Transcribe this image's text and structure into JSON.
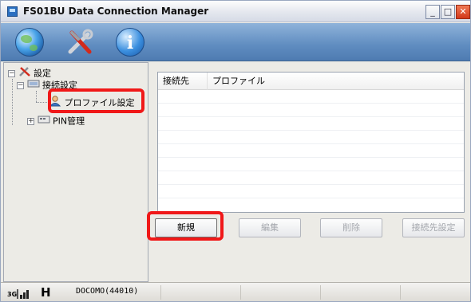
{
  "window": {
    "title": "FS01BU Data Connection Manager"
  },
  "toolbar": {
    "icons": [
      "globe-icon",
      "tools-icon",
      "info-icon"
    ],
    "info_glyph": "i"
  },
  "tree": {
    "root_label": "設定",
    "child_connection": "接続設定",
    "profile_settings": "プロファイル設定",
    "pin_management": "PIN管理",
    "expander_minus": "−",
    "expander_plus": "+"
  },
  "list": {
    "columns": [
      "接続先",
      "プロファイル"
    ]
  },
  "buttons": {
    "new_label": "新規",
    "edit_label": "編集",
    "delete_label": "削除",
    "connect_settings_label": "接続先設定"
  },
  "status": {
    "network_type": "3G",
    "network_mode": "H",
    "carrier": "DOCOMO(44010)"
  },
  "colors": {
    "highlight": "#f01818",
    "toolbar": "#5f8cc0"
  }
}
